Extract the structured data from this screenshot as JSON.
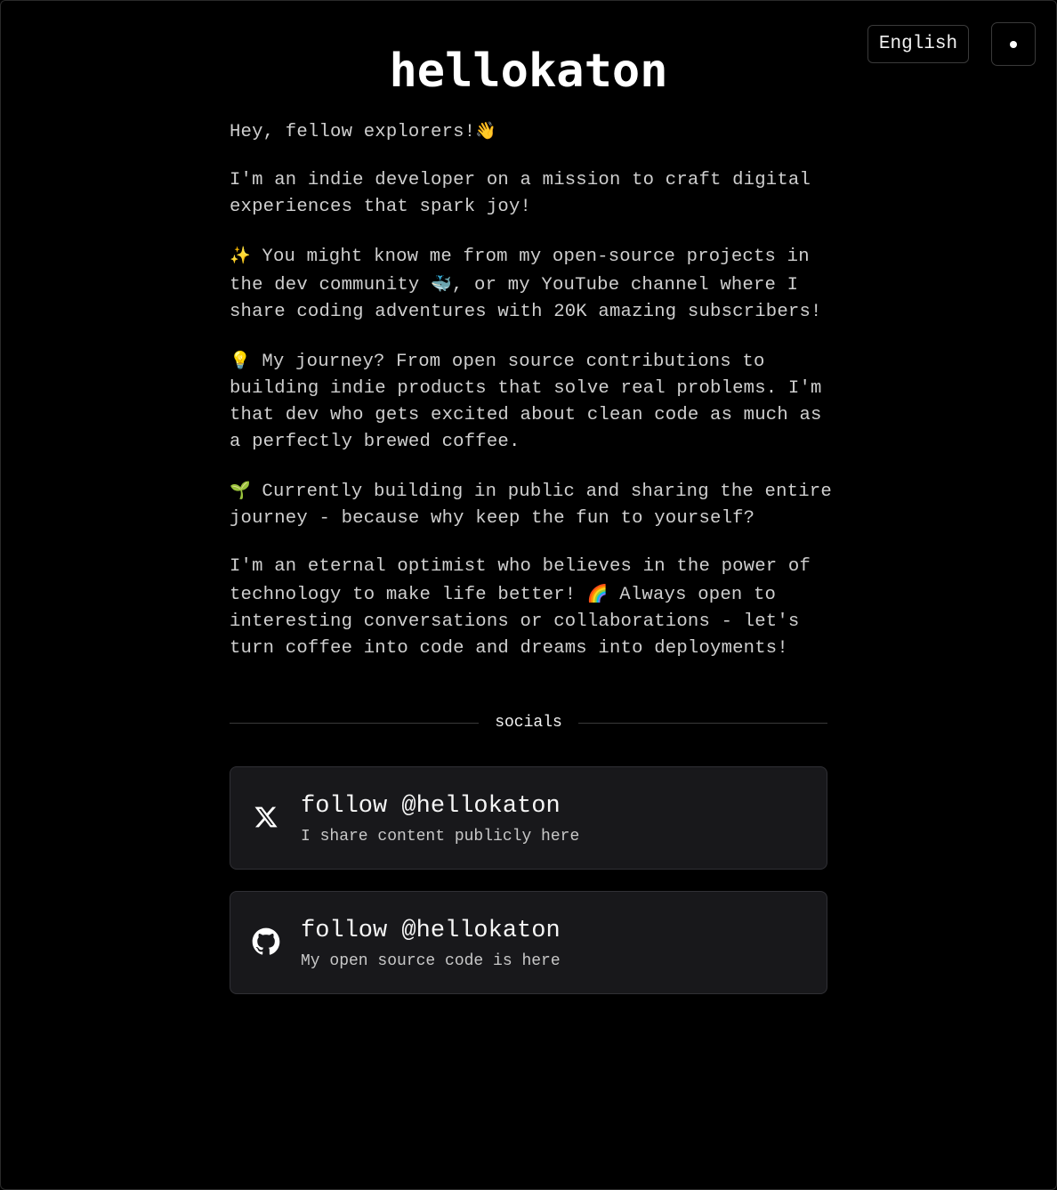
{
  "header": {
    "language_label": "English",
    "theme_toggle_icon": "dot-icon"
  },
  "title": "hellokaton",
  "intro": {
    "p1_text": "Hey, fellow explorers!",
    "p1_emoji": "👋",
    "p2_text": "I'm an indie developer on a mission to craft digital experiences that spark joy!",
    "p3_emoji": "✨",
    "p3_text_a": "You might know me from my open-source projects in the dev community",
    "p3_emoji_b": "🐳",
    "p3_text_b": ", or my YouTube channel where I share coding adventures with 20K amazing subscribers!",
    "p4_emoji": "💡",
    "p4_text": "My journey? From open source contributions to building indie products that solve real problems. I'm that dev who gets excited about clean code as much as a perfectly brewed coffee.",
    "p5_emoji": "🌱",
    "p5_text": "Currently building in public and sharing the entire journey - because why keep the fun to yourself?",
    "p6_text_a": "I'm an eternal optimist who believes in the power of technology to make life better!",
    "p6_emoji": "🌈",
    "p6_text_b": "Always open to interesting conversations or collaborations - let's turn coffee into code and dreams into deployments!"
  },
  "socials": {
    "label": "socials",
    "items": [
      {
        "icon": "x-logo-icon",
        "title": "follow @hellokaton",
        "subtitle": "I share content publicly here"
      },
      {
        "icon": "github-icon",
        "title": "follow @hellokaton",
        "subtitle": "My open source code is here"
      }
    ]
  }
}
